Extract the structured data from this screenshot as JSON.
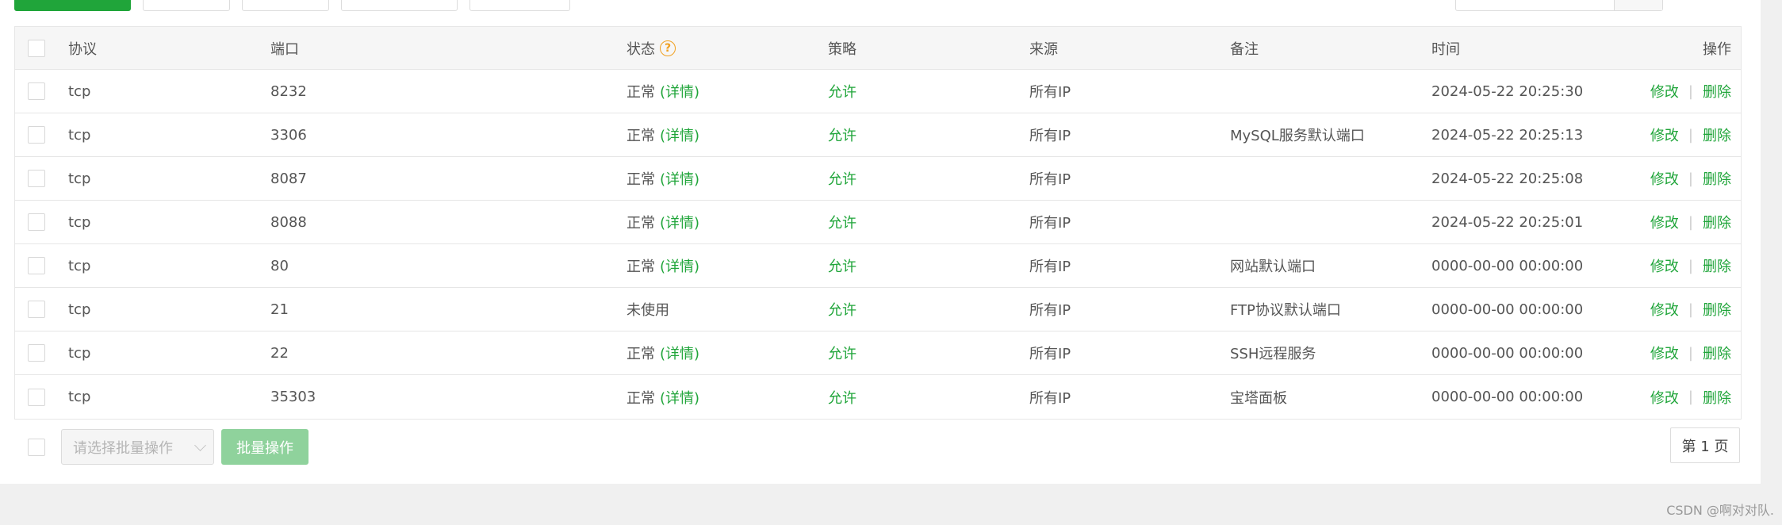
{
  "table": {
    "headers": {
      "protocol": "协议",
      "port": "端口",
      "status": "状态",
      "policy": "策略",
      "source": "来源",
      "remark": "备注",
      "time": "时间",
      "ops": "操作"
    },
    "help_icon_glyph": "?",
    "rows": [
      {
        "protocol": "tcp",
        "port": "8232",
        "status": "正常",
        "detail": "(详情)",
        "policy": "允许",
        "source": "所有IP",
        "remark": "",
        "time": "2024-05-22 20:25:30",
        "edit": "修改",
        "sep": "|",
        "del": "删除"
      },
      {
        "protocol": "tcp",
        "port": "3306",
        "status": "正常",
        "detail": "(详情)",
        "policy": "允许",
        "source": "所有IP",
        "remark": "MySQL服务默认端口",
        "time": "2024-05-22 20:25:13",
        "edit": "修改",
        "sep": "|",
        "del": "删除"
      },
      {
        "protocol": "tcp",
        "port": "8087",
        "status": "正常",
        "detail": "(详情)",
        "policy": "允许",
        "source": "所有IP",
        "remark": "",
        "time": "2024-05-22 20:25:08",
        "edit": "修改",
        "sep": "|",
        "del": "删除"
      },
      {
        "protocol": "tcp",
        "port": "8088",
        "status": "正常",
        "detail": "(详情)",
        "policy": "允许",
        "source": "所有IP",
        "remark": "",
        "time": "2024-05-22 20:25:01",
        "edit": "修改",
        "sep": "|",
        "del": "删除"
      },
      {
        "protocol": "tcp",
        "port": "80",
        "status": "正常",
        "detail": "(详情)",
        "policy": "允许",
        "source": "所有IP",
        "remark": "网站默认端口",
        "time": "0000-00-00 00:00:00",
        "edit": "修改",
        "sep": "|",
        "del": "删除"
      },
      {
        "protocol": "tcp",
        "port": "21",
        "status": "未使用",
        "detail": "",
        "policy": "允许",
        "source": "所有IP",
        "remark": "FTP协议默认端口",
        "time": "0000-00-00 00:00:00",
        "edit": "修改",
        "sep": "|",
        "del": "删除"
      },
      {
        "protocol": "tcp",
        "port": "22",
        "status": "正常",
        "detail": "(详情)",
        "policy": "允许",
        "source": "所有IP",
        "remark": "SSH远程服务",
        "time": "0000-00-00 00:00:00",
        "edit": "修改",
        "sep": "|",
        "del": "删除"
      },
      {
        "protocol": "tcp",
        "port": "35303",
        "status": "正常",
        "detail": "(详情)",
        "policy": "允许",
        "source": "所有IP",
        "remark": "宝塔面板",
        "time": "0000-00-00 00:00:00",
        "edit": "修改",
        "sep": "|",
        "del": "删除"
      }
    ]
  },
  "bottom": {
    "batch_placeholder": "请选择批量操作",
    "batch_button": "批量操作",
    "pager": "第 1 页"
  },
  "watermark": "CSDN @啊对对队.",
  "colors": {
    "accent_green": "#20a53a",
    "help_orange": "#f0a020"
  }
}
